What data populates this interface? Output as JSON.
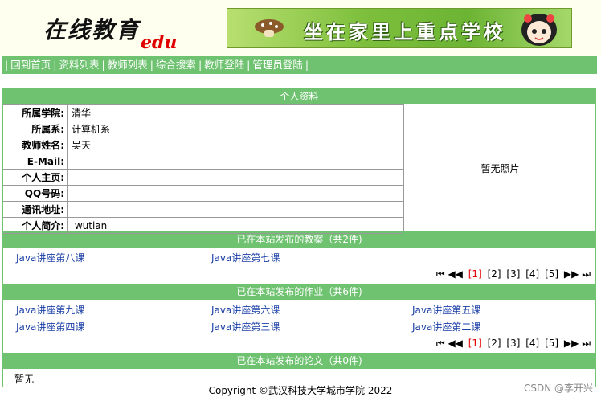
{
  "header": {
    "logo_text": "在线教育",
    "logo_edu": "edu",
    "banner_text": "坐在家里上重点学校"
  },
  "nav": [
    {
      "label": "回到首页"
    },
    {
      "label": "资料列表"
    },
    {
      "label": "教师列表"
    },
    {
      "label": "综合搜索"
    },
    {
      "label": "教师登陆"
    },
    {
      "label": "管理员登陆"
    }
  ],
  "profile": {
    "title": "个人资料",
    "rows": [
      {
        "label": "所属学院:",
        "value": "清华"
      },
      {
        "label": "所属系:",
        "value": "计算机系"
      },
      {
        "label": "教师姓名:",
        "value": "吴天"
      },
      {
        "label": "E-Mail:",
        "value": ""
      },
      {
        "label": "个人主页:",
        "value": ""
      },
      {
        "label": "QQ号码:",
        "value": ""
      },
      {
        "label": "通讯地址:",
        "value": ""
      },
      {
        "label": "个人简介:",
        "value": " wutian"
      }
    ],
    "photo_text": "暂无照片"
  },
  "lessons": {
    "title": "已在本站发布的教案（共2件)",
    "items": [
      "Java讲座第八课",
      "Java讲座第七课"
    ],
    "pager": {
      "first": "⏮",
      "prev": "◀◀",
      "pages": [
        "[1]",
        "[2]",
        "[3]",
        "[4]",
        "[5]"
      ],
      "next": "▶▶",
      "last": "⏭"
    }
  },
  "homework": {
    "title": "已在本站发布的作业（共6件)",
    "items": [
      "Java讲座第九课",
      "Java讲座第六课",
      "Java讲座第五课",
      "Java讲座第四课",
      "Java讲座第三课",
      "Java讲座第二课"
    ],
    "pager": {
      "pages": [
        "[1]",
        "[2]",
        "[3]",
        "[4]",
        "[5]"
      ]
    }
  },
  "papers": {
    "title": "已在本站发布的论文（共0件)",
    "empty": "暂无"
  },
  "footer": {
    "copyright": "Copyright ©武汉科技大学城市学院 2022",
    "watermark": "CSDN @李开兴"
  },
  "colors": {
    "accent": "#6ec270",
    "link": "#1a3fa6",
    "current_page": "#e00000"
  }
}
